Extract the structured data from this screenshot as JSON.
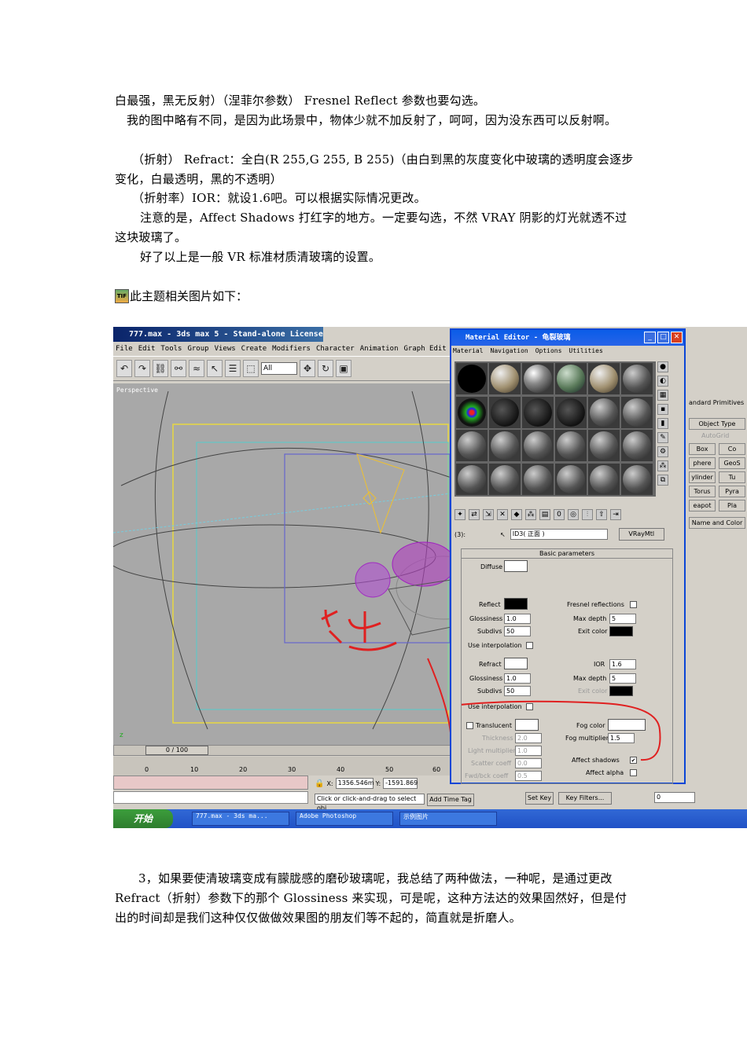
{
  "doc": {
    "p1": "白最强，黑无反射）（涅菲尔参数）   Fresnel Reflect 参数也要勾选。",
    "p2": "我的图中略有不同，是因为此场景中，物体少就不加反射了，呵呵，因为没东西可以反射啊。",
    "p3": "（折射）  Refract：全白(R 255,G 255, B 255)（由白到黑的灰度变化中玻璃的透明度会逐步变化，白最透明，黑的不透明）",
    "p4": "（折射率）IOR：就设1.6吧。可以根据实际情况更改。",
    "p5": "注意的是，Affect Shadows 打红字的地方。一定要勾选，不然 VRAY 阴影的灯光就透不过这块玻璃了。",
    "p6": "好了以上是一般 VR 标准材质清玻璃的设置。",
    "caption": "此主题相关图片如下：",
    "caption_icon": "TIF",
    "p7": "3，如果要使清玻璃变成有朦胧感的磨砂玻璃呢，我总结了两种做法，一种呢，是通过更改 Refract（折射）参数下的那个 Glossiness 来实现，可是呢，这种方法达的效果固然好，但是付出的时间却是我们这种仅仅做做效果图的朋友们等不起的，简直就是折磨人。"
  },
  "max": {
    "title": "777.max - 3ds max 5 - Stand-alone License",
    "menus": [
      "File",
      "Edit",
      "Tools",
      "Group",
      "Views",
      "Create",
      "Modifiers",
      "Character",
      "Animation",
      "Graph Edit"
    ],
    "select_filter": "All",
    "viewport_label": "Perspective",
    "time_slider": "0 / 100",
    "ticks": [
      "0",
      "10",
      "20",
      "30",
      "40",
      "50",
      "60"
    ],
    "x_coord": "1356.546m",
    "y_coord": "-1591.869",
    "status_prompt": "Click or click-and-drag to select obj",
    "add_time_tag": "Add Time Tag",
    "set_key": "Set Key",
    "key_filters": "Key Filters...",
    "frame": "0",
    "annotation": "注意"
  },
  "me": {
    "title": "Material Editor - 龟裂玻璃",
    "menus": [
      "Material",
      "Navigation",
      "Options",
      "Utilities"
    ],
    "slot_label": "(3):",
    "mat_name": "ID3( 正面 )",
    "mat_type": "VRayMtl",
    "rollout": "Basic parameters",
    "diffuse": "Diffuse",
    "reflect": "Reflect",
    "glossiness": "Glossiness",
    "subdivs": "Subdivs",
    "use_interp": "Use interpolation",
    "fresnel": "Fresnel reflections",
    "max_depth": "Max depth",
    "exit_color": "Exit color",
    "refl_gloss_val": "1.0",
    "refl_subdivs_val": "50",
    "refl_depth_val": "5",
    "refract": "Refract",
    "ior": "IOR",
    "ior_val": "1.6",
    "refr_gloss_val": "1.0",
    "refr_subdivs_val": "50",
    "refr_depth_val": "5",
    "translucent": "Translucent",
    "thickness": "Thickness",
    "thickness_val": "2.0",
    "light_mult": "Light multiplier",
    "light_mult_val": "1.0",
    "scatter": "Scatter coeff",
    "scatter_val": "0.0",
    "fwd_bck": "Fwd/bck coeff",
    "fwd_bck_val": "0.5",
    "fog_color": "Fog color",
    "fog_mult": "Fog multiplier",
    "fog_mult_val": "1.5",
    "affect_shadows": "Affect shadows",
    "affect_alpha": "Affect alpha"
  },
  "cmd": {
    "category": "andard Primitives",
    "object_type": "Object Type",
    "autogrid": "AutoGrid",
    "items": [
      "Box",
      "Co",
      "phere",
      "GeoS",
      "ylinder",
      "Tu",
      "Torus",
      "Pyra",
      "eapot",
      "Pla"
    ],
    "name_color": "Name and Color"
  },
  "taskbar": {
    "start": "开始",
    "tasks": [
      "777.max - 3ds ma...",
      "Adobe Photoshop",
      "示例图片"
    ]
  },
  "colors": {
    "annotation_red": "#e02020",
    "me_border": "#0a46d6"
  }
}
